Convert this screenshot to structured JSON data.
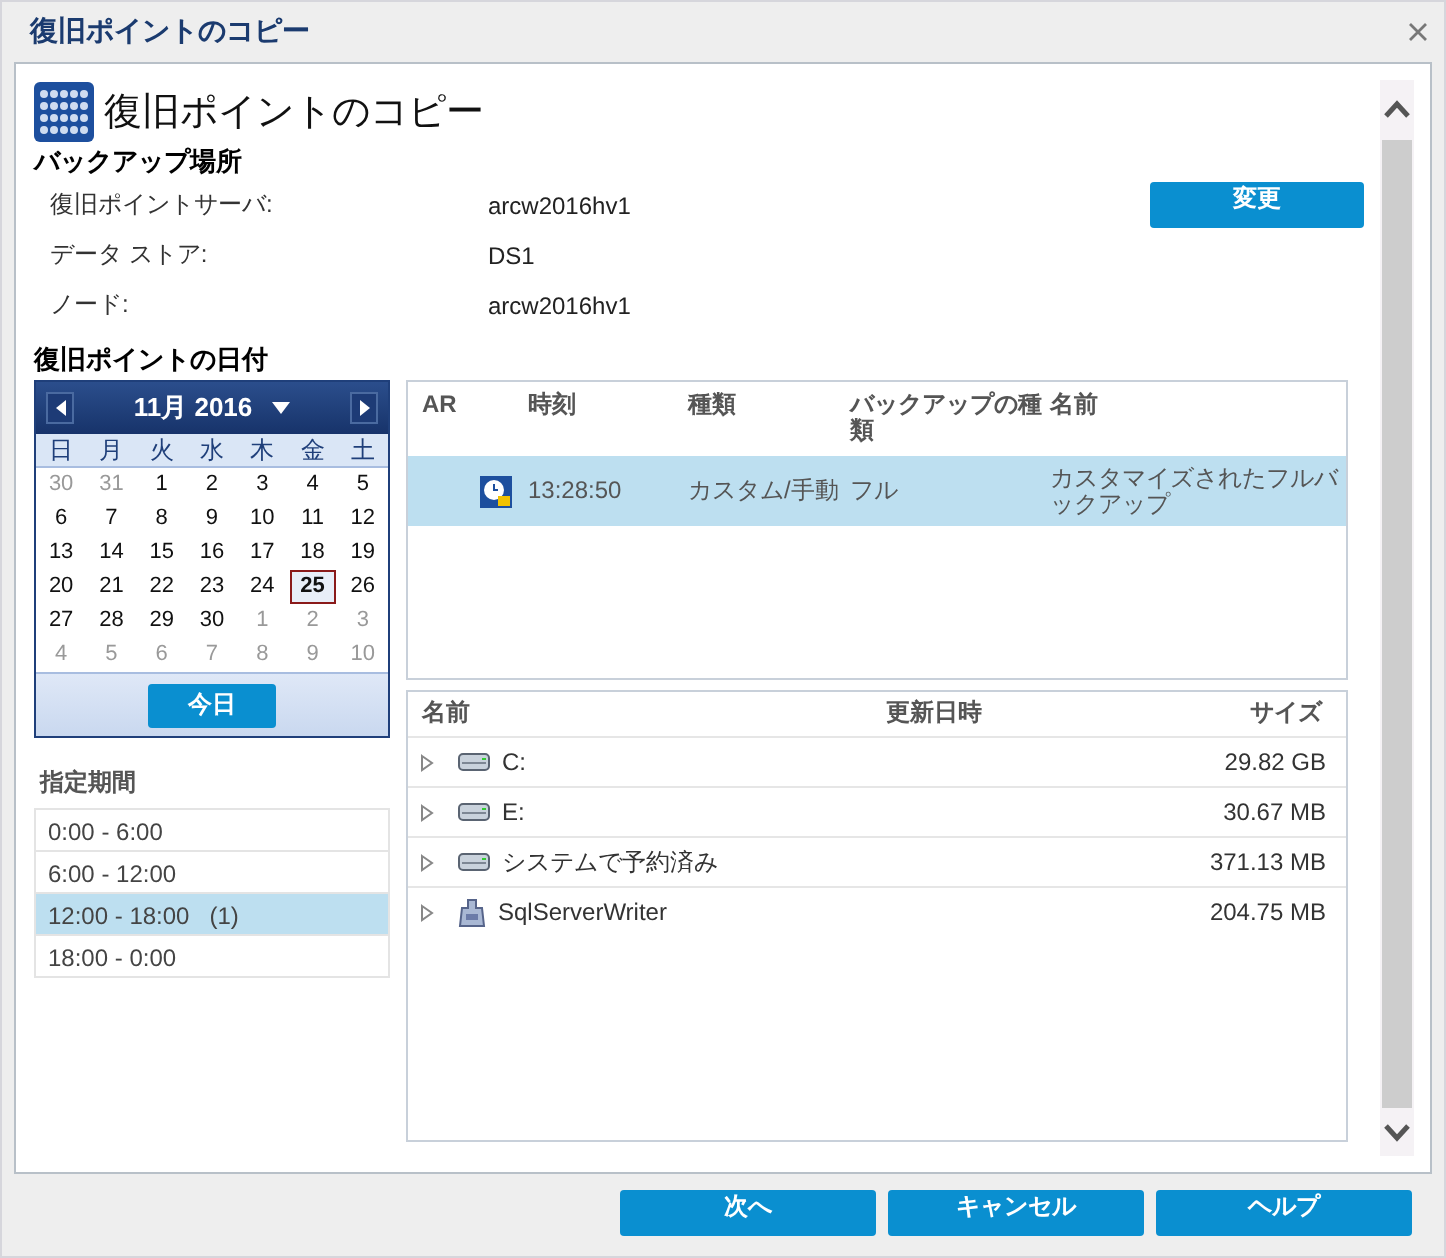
{
  "window": {
    "title": "復旧ポイントのコピー"
  },
  "header": {
    "title": "復旧ポイントのコピー"
  },
  "backup_location": {
    "heading": "バックアップ場所",
    "change_button": "変更",
    "fields": [
      {
        "label": "復旧ポイントサーバ:",
        "value": "arcw2016hv1"
      },
      {
        "label": "データ ストア:",
        "value": "DS1"
      },
      {
        "label": "ノード:",
        "value": "arcw2016hv1"
      }
    ]
  },
  "recovery_date": {
    "heading": "復旧ポイントの日付"
  },
  "calendar": {
    "month_label": "11月 2016",
    "weekdays": [
      "日",
      "月",
      "火",
      "水",
      "木",
      "金",
      "土"
    ],
    "days": [
      {
        "label": "30",
        "in_month": false,
        "selected": false
      },
      {
        "label": "31",
        "in_month": false,
        "selected": false
      },
      {
        "label": "1",
        "in_month": true,
        "selected": false
      },
      {
        "label": "2",
        "in_month": true,
        "selected": false
      },
      {
        "label": "3",
        "in_month": true,
        "selected": false
      },
      {
        "label": "4",
        "in_month": true,
        "selected": false
      },
      {
        "label": "5",
        "in_month": true,
        "selected": false
      },
      {
        "label": "6",
        "in_month": true,
        "selected": false
      },
      {
        "label": "7",
        "in_month": true,
        "selected": false
      },
      {
        "label": "8",
        "in_month": true,
        "selected": false
      },
      {
        "label": "9",
        "in_month": true,
        "selected": false
      },
      {
        "label": "10",
        "in_month": true,
        "selected": false
      },
      {
        "label": "11",
        "in_month": true,
        "selected": false
      },
      {
        "label": "12",
        "in_month": true,
        "selected": false
      },
      {
        "label": "13",
        "in_month": true,
        "selected": false
      },
      {
        "label": "14",
        "in_month": true,
        "selected": false
      },
      {
        "label": "15",
        "in_month": true,
        "selected": false
      },
      {
        "label": "16",
        "in_month": true,
        "selected": false
      },
      {
        "label": "17",
        "in_month": true,
        "selected": false
      },
      {
        "label": "18",
        "in_month": true,
        "selected": false
      },
      {
        "label": "19",
        "in_month": true,
        "selected": false
      },
      {
        "label": "20",
        "in_month": true,
        "selected": false
      },
      {
        "label": "21",
        "in_month": true,
        "selected": false
      },
      {
        "label": "22",
        "in_month": true,
        "selected": false
      },
      {
        "label": "23",
        "in_month": true,
        "selected": false
      },
      {
        "label": "24",
        "in_month": true,
        "selected": false
      },
      {
        "label": "25",
        "in_month": true,
        "selected": true
      },
      {
        "label": "26",
        "in_month": true,
        "selected": false
      },
      {
        "label": "27",
        "in_month": true,
        "selected": false
      },
      {
        "label": "28",
        "in_month": true,
        "selected": false
      },
      {
        "label": "29",
        "in_month": true,
        "selected": false
      },
      {
        "label": "30",
        "in_month": true,
        "selected": false
      },
      {
        "label": "1",
        "in_month": false,
        "selected": false
      },
      {
        "label": "2",
        "in_month": false,
        "selected": false
      },
      {
        "label": "3",
        "in_month": false,
        "selected": false
      },
      {
        "label": "4",
        "in_month": false,
        "selected": false
      },
      {
        "label": "5",
        "in_month": false,
        "selected": false
      },
      {
        "label": "6",
        "in_month": false,
        "selected": false
      },
      {
        "label": "7",
        "in_month": false,
        "selected": false
      },
      {
        "label": "8",
        "in_month": false,
        "selected": false
      },
      {
        "label": "9",
        "in_month": false,
        "selected": false
      },
      {
        "label": "10",
        "in_month": false,
        "selected": false
      }
    ],
    "today_button": "今日"
  },
  "periods": {
    "heading": "指定期間",
    "items": [
      {
        "label": "0:00 - 6:00",
        "selected": false
      },
      {
        "label": "6:00 - 12:00",
        "selected": false
      },
      {
        "label": "12:00 - 18:00   (1)",
        "selected": true
      },
      {
        "label": "18:00 - 0:00",
        "selected": false
      }
    ]
  },
  "recovery_points": {
    "columns": [
      "AR",
      "時刻",
      "種類",
      "バックアップの種類",
      "名前"
    ],
    "rows": [
      {
        "time": "13:28:50",
        "type": "カスタム/手動",
        "backup_type": "フル",
        "name": "カスタマイズされたフルバックアップ",
        "selected": true
      }
    ]
  },
  "files": {
    "columns": [
      "名前",
      "更新日時",
      "サイズ"
    ],
    "rows": [
      {
        "kind": "drive",
        "name": "C:",
        "size": "29.82 GB",
        "expanded": false
      },
      {
        "kind": "drive",
        "name": "E:",
        "size": "30.67 MB",
        "expanded": false
      },
      {
        "kind": "drive",
        "name": "システムで予約済み",
        "size": "371.13 MB",
        "expanded": false
      },
      {
        "kind": "writer",
        "name": "SqlServerWriter",
        "size": "204.75 MB",
        "expanded": false
      }
    ]
  },
  "buttons": [
    "次へ",
    "キャンセル",
    "ヘルプ"
  ]
}
